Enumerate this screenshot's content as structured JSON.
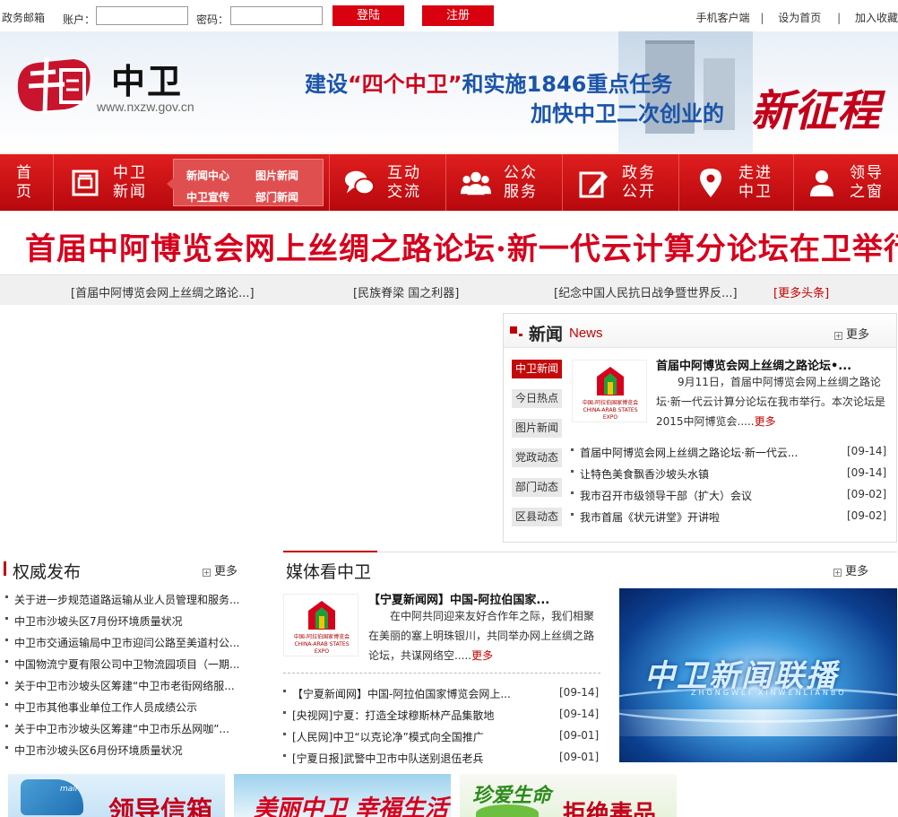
{
  "topbar": {
    "mail_label": "政务邮箱",
    "account_label": "账户：",
    "password_label": "密码：",
    "login_label": "登陆",
    "register_label": "注册",
    "links": [
      "手机客户端",
      "设为首页",
      "加入收藏"
    ],
    "sep": "|"
  },
  "banner": {
    "logo_glyph": "中国",
    "logo_text": "中卫",
    "logo_url": "www.nxzw.gov.cn",
    "slogan_a": "建设",
    "slogan_b": "“四个中卫”",
    "slogan_c": "和实施1846重点任务",
    "slogan_line2": "加快中卫二次创业的",
    "slogan_art": "新征程"
  },
  "nav": {
    "items": [
      {
        "label1": "首",
        "label2": "页"
      },
      {
        "label1": "中卫",
        "label2": "新闻"
      },
      {
        "label1": "互动",
        "label2": "交流"
      },
      {
        "label1": "公众",
        "label2": "服务"
      },
      {
        "label1": "政务",
        "label2": "公开"
      },
      {
        "label1": "走进",
        "label2": "中卫"
      },
      {
        "label1": "领导",
        "label2": "之窗"
      }
    ],
    "sub": [
      "新闻中心",
      "图片新闻",
      "中卫宣传",
      "部门新闻"
    ]
  },
  "headline": {
    "title": "首届中阿博览会网上丝绸之路论坛·新一代云计算分论坛在卫举行",
    "subs": [
      "[首届中阿博览会网上丝绸之路论...]",
      "[民族脊梁 国之利器]",
      "[纪念中国人民抗日战争暨世界反...]"
    ],
    "more": "[更多头条]"
  },
  "news": {
    "title_cn": "新闻",
    "title_en": "News",
    "more": "更多",
    "tabs": [
      "中卫新闻",
      "今日热点",
      "图片新闻",
      "党政动态",
      "部门动态",
      "区县动态"
    ],
    "featured_title": "首届中阿博览会网上丝绸之路论坛•...",
    "featured_body": "9月11日，首届中阿博览会网上丝绸之路论坛·新一代云计算分论坛在我市举行。本次论坛是2015中阿博览会.....",
    "featured_more": "更多",
    "thumb_caption": "中国-阿拉伯国家博览会 CHINA-ARAB STATES EXPO",
    "items": [
      {
        "text": "首届中阿博览会网上丝绸之路论坛·新一代云...",
        "date": "[09-14]"
      },
      {
        "text": "让特色美食飘香沙坡头水镇",
        "date": "[09-14]"
      },
      {
        "text": "我市召开市级领导干部（扩大）会议",
        "date": "[09-02]"
      },
      {
        "text": "我市首届《状元讲堂》开讲啦",
        "date": "[09-02]"
      }
    ]
  },
  "authority": {
    "title": "权威发布",
    "more": "更多",
    "items": [
      "关于进一步规范道路运输从业人员管理和服务...",
      "中卫市沙坡头区7月份环境质量状况",
      "中卫市交通运输局中卫市迎闫公路至美道村公...",
      "中国物流宁夏有限公司中卫物流园项目（一期...",
      "关于中卫市沙坡头区筹建“中卫市老街网络服...",
      "中卫市其他事业单位工作人员成绩公示",
      "关于中卫市沙坡头区筹建“中卫市乐丛网咖”...",
      "中卫市沙坡头区6月份环境质量状况"
    ]
  },
  "media": {
    "title": "媒体看中卫",
    "more": "更多",
    "featured_title": "【宁夏新闻网】中国-阿拉伯国家...",
    "featured_body": "在中阿共同迎来友好合作年之际，我们相聚在美丽的塞上明珠银川，共同举办网上丝绸之路论坛，共谋网络空.....",
    "featured_more": "更多",
    "items": [
      {
        "text": "【宁夏新闻网】中国-阿拉伯国家博览会网上...",
        "date": "[09-14]"
      },
      {
        "text": "[央视网]宁夏：打造全球穆斯林产品集散地",
        "date": "[09-14]"
      },
      {
        "text": "[人民网]中卫“以克论净”模式向全国推广",
        "date": "[09-01]"
      },
      {
        "text": "[宁夏日报]武警中卫市中队送别退伍老兵",
        "date": "[09-01]"
      }
    ],
    "video_title": "中卫新闻联播",
    "video_sub": "ZHONGWEI XINWENLIANBO"
  },
  "bottom_banners": {
    "leader_mail": "领导信箱",
    "mail_word": "mail",
    "beautiful": "美丽中卫 幸福生活",
    "cherish": "珍爱生命",
    "refuse": "拒绝毒品"
  },
  "colors": {
    "brand_red": "#c30000",
    "nav_red": "#d31414",
    "slogan_blue": "#1a54a8"
  }
}
